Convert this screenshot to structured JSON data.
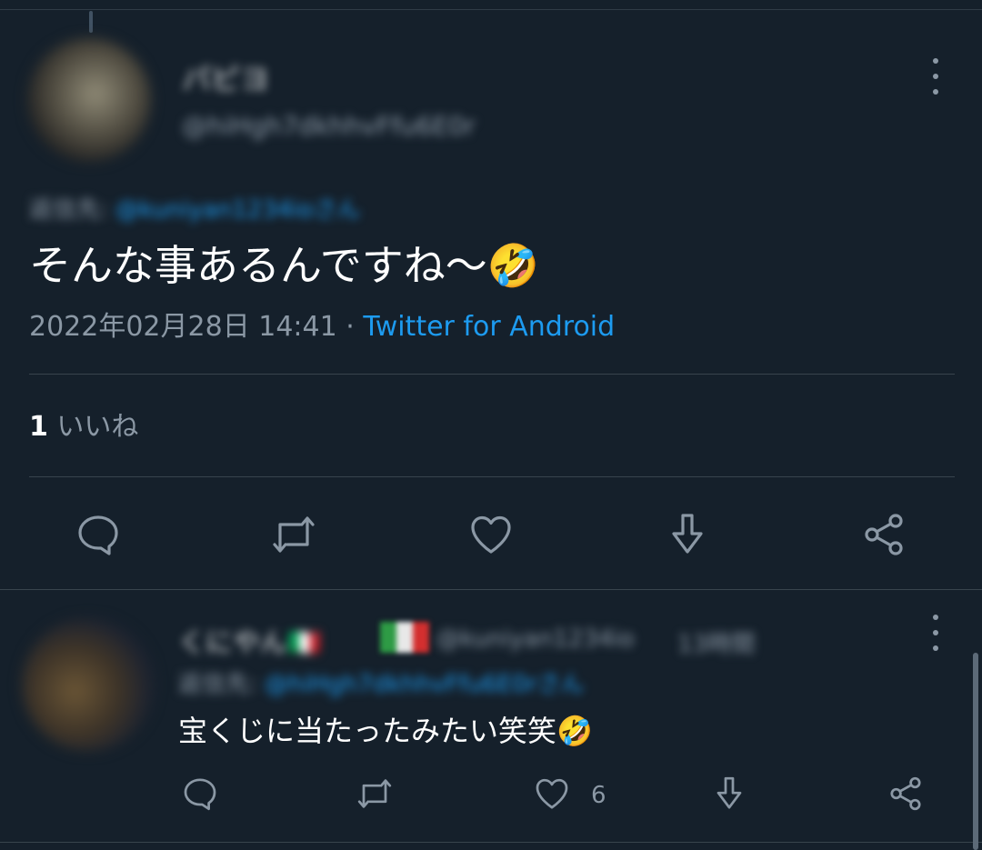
{
  "main_tweet": {
    "display_name": "パピヨ",
    "handle": "@hiHgh7dkhhvFfu6E0r",
    "replying_to_label": "返信先:",
    "replying_to_handle": "@kuniyan1234ioさん",
    "text": "そんな事あるんですね〜🤣",
    "timestamp": "2022年02月28日 14:41",
    "separator": "·",
    "source": "Twitter for Android",
    "likes_count": "1",
    "likes_label": "いいね"
  },
  "reply_tweet": {
    "display_name": "くにやん🇮🇹",
    "handle": "@kuniyan1234io",
    "time_ago": "13時間",
    "replying_to_label": "返信先:",
    "replying_to_handle": "@hiHgh7dkhhvFfu6E0rさん",
    "text": "宝くじに当たったみたい笑笑🤣",
    "likes_count": "6"
  },
  "icons": [
    "more-vertical-icon",
    "reply-icon",
    "retweet-icon",
    "like-icon",
    "download-icon",
    "share-icon"
  ],
  "colors": {
    "background": "#15202b",
    "accent": "#1d9bf0",
    "muted": "#8b98a5",
    "divider": "#38444d"
  }
}
